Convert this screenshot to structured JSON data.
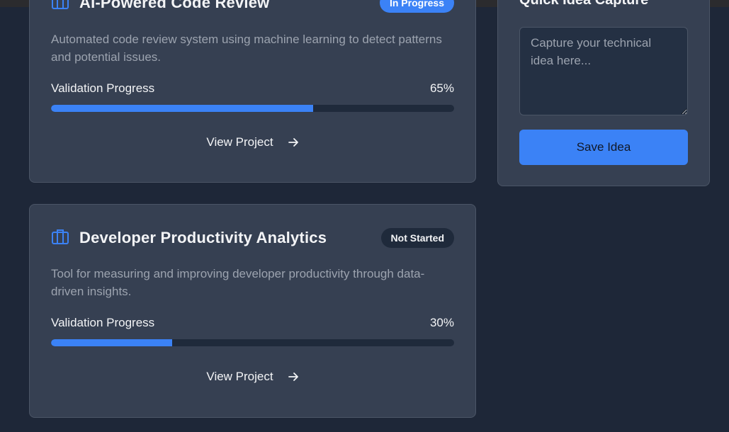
{
  "projects": [
    {
      "title": "AI-Powered Code Review",
      "status": "In Progress",
      "description": "Automated code review system using machine learning to detect patterns and potential issues.",
      "progress_label": "Validation Progress",
      "progress_value": 0.65,
      "progress_text": "65%",
      "view_label": "View Project",
      "icon": "briefcase-icon"
    },
    {
      "title": "Developer Productivity Analytics",
      "status": "Not Started",
      "description": "Tool for measuring and improving developer productivity through data-driven insights.",
      "progress_label": "Validation Progress",
      "progress_value": 0.3,
      "progress_text": "30%",
      "view_label": "View Project",
      "icon": "briefcase-icon"
    }
  ],
  "quick_idea": {
    "title": "Quick Idea Capture",
    "placeholder": "Capture your technical idea here...",
    "value": "",
    "save_label": "Save Idea"
  },
  "colors": {
    "background": "#1e2738",
    "card": "#364052",
    "accent": "#3b82f6",
    "track": "#1f2a3b"
  }
}
